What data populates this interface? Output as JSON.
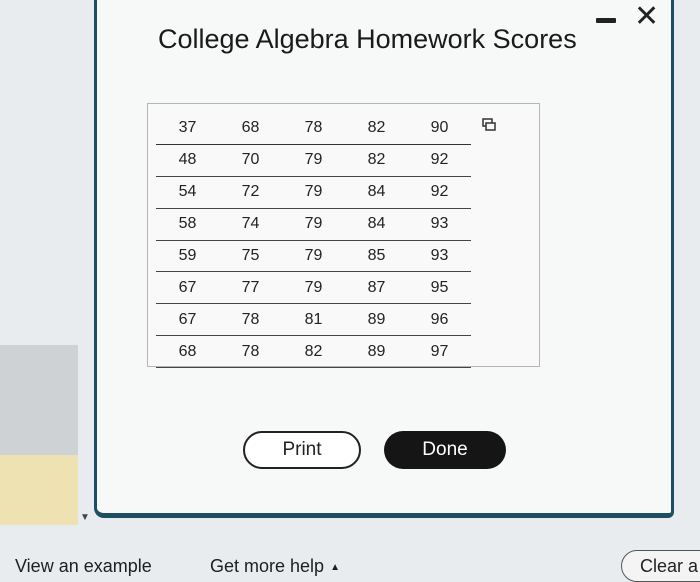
{
  "dialog": {
    "title": "College Algebra Homework Scores",
    "minimize_glyph": "",
    "close_glyph": "✕",
    "scores_table": [
      [
        "37",
        "68",
        "78",
        "82",
        "90"
      ],
      [
        "48",
        "70",
        "79",
        "82",
        "92"
      ],
      [
        "54",
        "72",
        "79",
        "84",
        "92"
      ],
      [
        "58",
        "74",
        "79",
        "84",
        "93"
      ],
      [
        "59",
        "75",
        "79",
        "85",
        "93"
      ],
      [
        "67",
        "77",
        "79",
        "87",
        "95"
      ],
      [
        "67",
        "78",
        "81",
        "89",
        "96"
      ],
      [
        "68",
        "78",
        "82",
        "89",
        "97"
      ]
    ],
    "copy_icon": "copy-icon",
    "print_label": "Print",
    "done_label": "Done"
  },
  "footer": {
    "view_example_label": "View an example",
    "get_help_label": "Get more help",
    "get_help_caret": "▲",
    "clear_label": "Clear a"
  },
  "colors": {
    "dialog_border": "#1f4e63",
    "done_button": "#151515",
    "left_panel_yellow": "#efe2b2"
  }
}
